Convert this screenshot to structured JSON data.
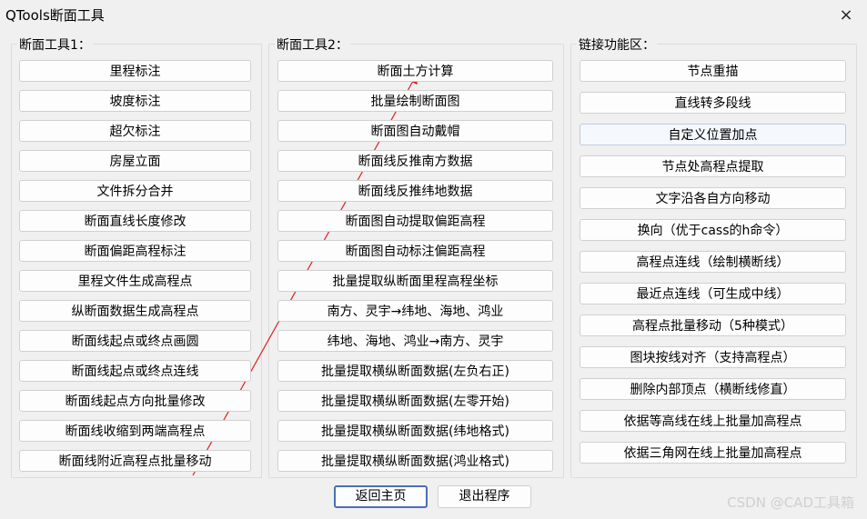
{
  "window": {
    "title": "QTools断面工具",
    "close_icon": "×"
  },
  "groups": {
    "g1": {
      "label": "断面工具1：",
      "buttons": [
        "里程标注",
        "坡度标注",
        "超欠标注",
        "房屋立面",
        "文件拆分合并",
        "断面直线长度修改",
        "断面偏距高程标注",
        "里程文件生成高程点",
        "纵断面数据生成高程点",
        "断面线起点或终点画圆",
        "断面线起点或终点连线",
        "断面线起点方向批量修改",
        "断面线收缩到两端高程点",
        "断面线附近高程点批量移动"
      ]
    },
    "g2": {
      "label": "断面工具2：",
      "buttons": [
        "断面土方计算",
        "批量绘制断面图",
        "断面图自动戴帽",
        "断面线反推南方数据",
        "断面线反推纬地数据",
        "断面图自动提取偏距高程",
        "断面图自动标注偏距高程",
        "批量提取纵断面里程高程坐标",
        "南方、灵宇→纬地、海地、鸿业",
        "纬地、海地、鸿业→南方、灵宇",
        "批量提取横纵断面数据(左负右正)",
        "批量提取横纵断面数据(左零开始)",
        "批量提取横纵断面数据(纬地格式)",
        "批量提取横纵断面数据(鸿业格式)"
      ]
    },
    "g3": {
      "label": "链接功能区：",
      "buttons": [
        "节点重描",
        "直线转多段线",
        "自定义位置加点",
        "节点处高程点提取",
        "文字沿各自方向移动",
        "换向（优于cass的h命令）",
        "高程点连线（绘制横断线）",
        "最近点连线（可生成中线）",
        "高程点批量移动（5种模式）",
        "图块按线对齐（支持高程点）",
        "删除内部顶点（横断线修直）",
        "依据等高线在线上批量加高程点",
        "依据三角网在线上批量加高程点"
      ]
    }
  },
  "footer": {
    "back_label": "返回主页",
    "exit_label": "退出程序"
  },
  "watermark": "CSDN @CAD工具箱",
  "annotation_color": "#e02020"
}
